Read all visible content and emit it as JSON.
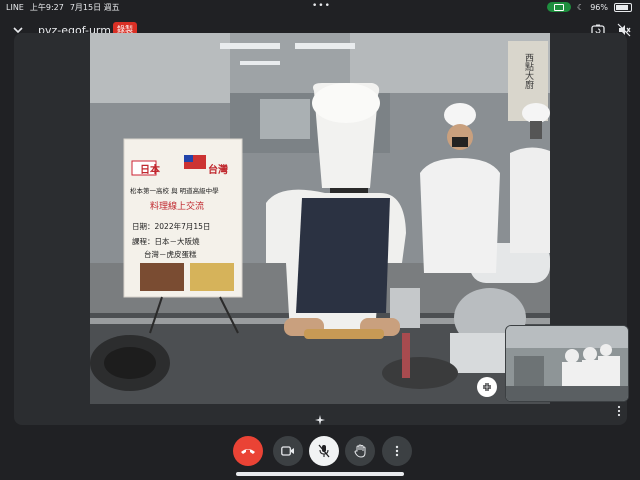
{
  "status_bar": {
    "carrier": "LINE",
    "time": "上午9:27",
    "date": "7月15日 週五",
    "battery": "96%"
  },
  "header": {
    "meeting_code": "pvz-egof-urm",
    "recording_badge": "錄製"
  },
  "video": {
    "sign": {
      "title_left": "日本",
      "title_right": "台灣",
      "line1": "松本第一高校 與 明道高級中學",
      "line2": "料理線上交流",
      "date_line": "日期：2022年7月15日",
      "course_line1": "課程：日本－大阪燒",
      "course_line2": "台灣－虎皮蛋糕"
    },
    "poster_right": "西點大廚"
  },
  "icons": {
    "accent_end_call": "#ea4335",
    "accent_record": "#d93025",
    "accent_camera_active": "#1e8e3e"
  }
}
